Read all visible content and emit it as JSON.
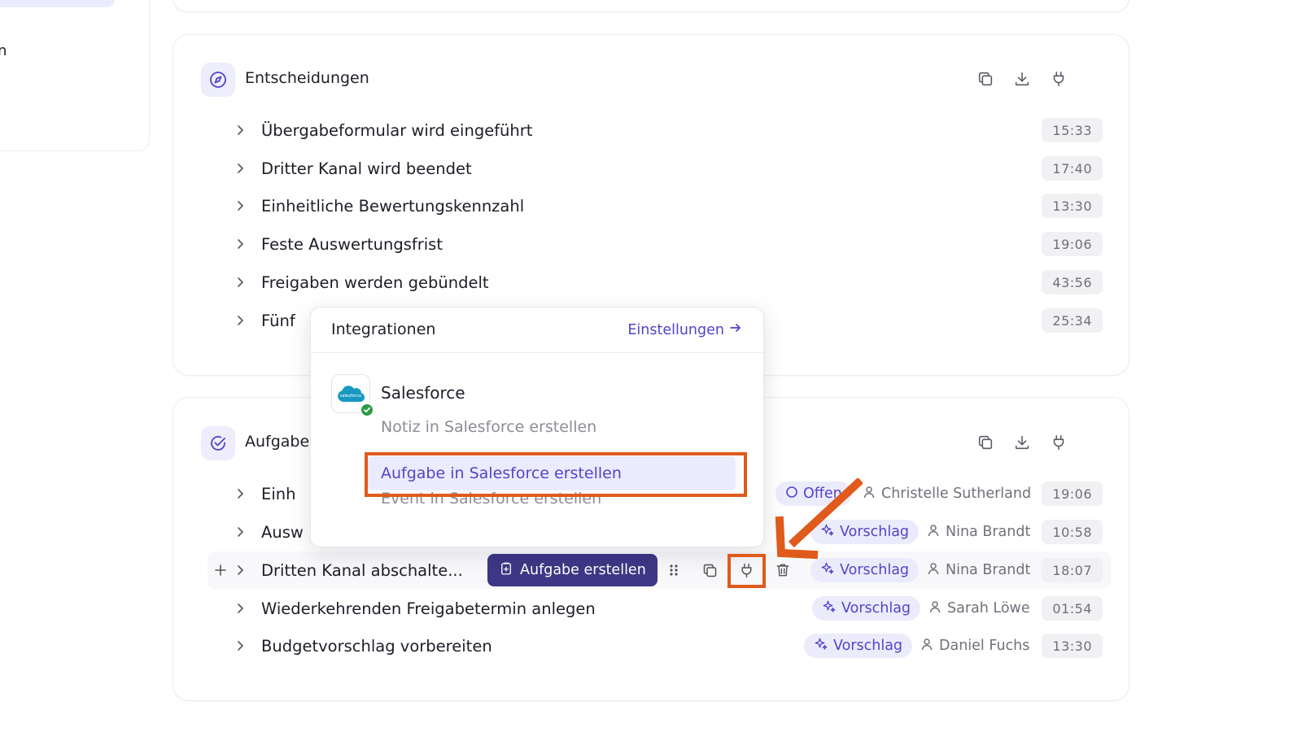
{
  "sidebar": {
    "partial_label": "n"
  },
  "decisions": {
    "title": "Entscheidungen",
    "items": [
      {
        "label": "Übergabeformular wird eingeführt",
        "time": "15:33"
      },
      {
        "label": "Dritter Kanal wird beendet",
        "time": "17:40"
      },
      {
        "label": "Einheitliche Bewertungskennzahl",
        "time": "13:30"
      },
      {
        "label": "Feste Auswertungsfrist",
        "time": "19:06"
      },
      {
        "label": "Freigaben werden gebündelt",
        "time": "43:56"
      },
      {
        "label": "Fünf",
        "time": "25:34"
      }
    ]
  },
  "tasks": {
    "title": "Aufgabe",
    "items": [
      {
        "label": "Einh",
        "status": "Offen",
        "assignee": "Christelle Sutherland",
        "time": "19:06"
      },
      {
        "label": "Ausw",
        "status": "Vorschlag",
        "assignee": "Nina Brandt",
        "time": "10:58"
      },
      {
        "label": "Dritten Kanal abschalte...",
        "status": "Vorschlag",
        "assignee": "Nina Brandt",
        "time": "18:07",
        "action": "Aufgabe erstellen"
      },
      {
        "label": "Wiederkehrenden Freigabetermin anlegen",
        "status": "Vorschlag",
        "assignee": "Sarah Löwe",
        "time": "01:54"
      },
      {
        "label": "Budgetvorschlag vorbereiten",
        "status": "Vorschlag",
        "assignee": "Daniel Fuchs",
        "time": "13:30"
      }
    ]
  },
  "popup": {
    "title": "Integrationen",
    "settings_link": "Einstellungen",
    "integration_name": "Salesforce",
    "logo_text": "salesforce",
    "options": [
      "Notiz in Salesforce erstellen",
      "Aufgabe in Salesforce erstellen",
      "Event in Salesforce erstellen"
    ]
  },
  "colors": {
    "accent": "#4f46c8",
    "primary_button": "#3d3785",
    "annotation": "#e05a1b",
    "salesforce_blue": "#1798c1",
    "success": "#2e9a48"
  },
  "icons": [
    "compass-icon",
    "check-circle-icon",
    "copy-icon",
    "download-icon",
    "plug-icon",
    "chevron-right-icon",
    "plus-icon",
    "drag-handle-icon",
    "trash-icon",
    "sparkle-icon",
    "user-icon",
    "clipboard-icon",
    "arrow-right-icon",
    "circle-open-icon",
    "checkmark-icon"
  ]
}
